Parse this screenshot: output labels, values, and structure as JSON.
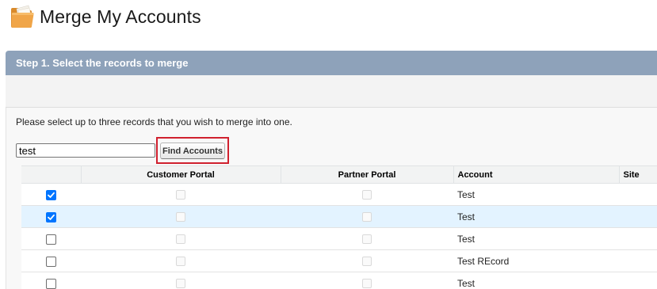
{
  "page": {
    "title": "Merge My Accounts",
    "icon": "folder-icon"
  },
  "step": {
    "title": "Step 1. Select the records to merge"
  },
  "instructions": "Please select up to three records that you wish to merge into one.",
  "search": {
    "value": "test",
    "button_label": "Find Accounts"
  },
  "table": {
    "columns": [
      "",
      "Customer Portal",
      "Partner Portal",
      "Account",
      "Site"
    ],
    "rows": [
      {
        "selected": true,
        "customer_portal": false,
        "partner_portal": false,
        "account": "Test",
        "site": ""
      },
      {
        "selected": true,
        "customer_portal": false,
        "partner_portal": false,
        "account": "Test",
        "site": ""
      },
      {
        "selected": false,
        "customer_portal": false,
        "partner_portal": false,
        "account": "Test",
        "site": ""
      },
      {
        "selected": false,
        "customer_portal": false,
        "partner_portal": false,
        "account": "Test REcord",
        "site": ""
      },
      {
        "selected": false,
        "customer_portal": false,
        "partner_portal": false,
        "account": "Test",
        "site": ""
      }
    ]
  },
  "colors": {
    "step_header": "#8ea2ba",
    "row_highlight": "#e3f3ff",
    "checkbox_checked": "#0075ff",
    "annotation_box": "#d0202e"
  }
}
